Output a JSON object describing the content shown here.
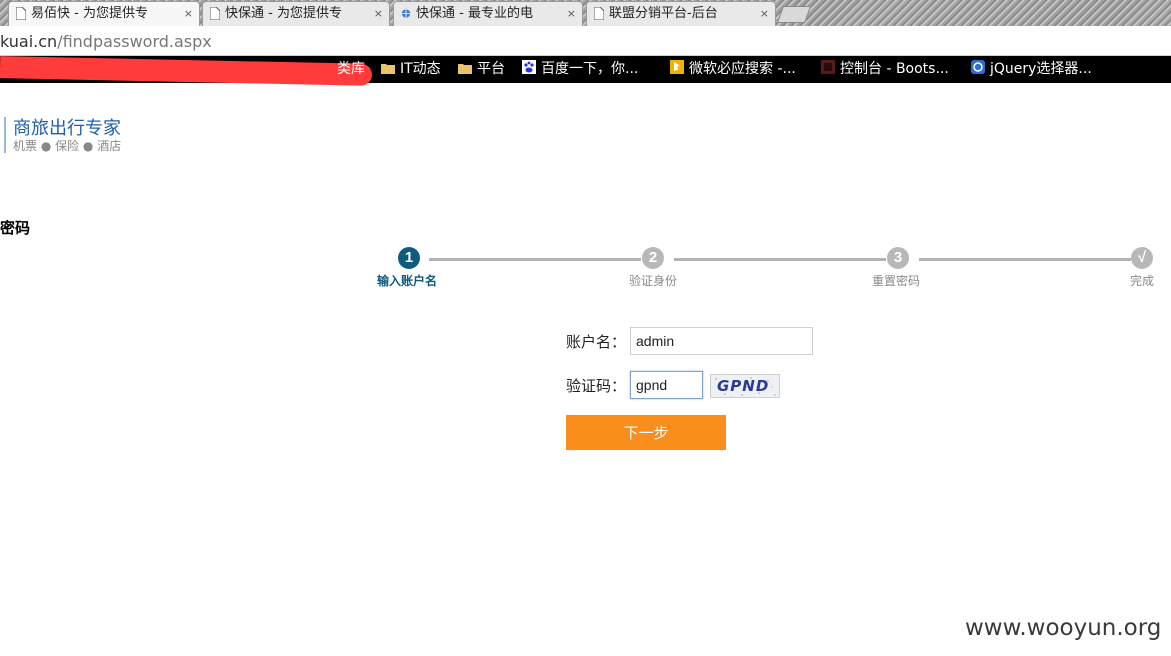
{
  "browser": {
    "tabs": [
      {
        "title": "易佰快 - 为您提供专",
        "close": "×",
        "icon": "page-icon"
      },
      {
        "title": "快保通 - 为您提供专",
        "close": "×",
        "icon": "page-icon"
      },
      {
        "title": "快保通 - 最专业的电",
        "close": "×",
        "icon": "globe-icon"
      },
      {
        "title": "联盟分销平台-后台",
        "close": "×",
        "icon": "page-icon"
      }
    ],
    "address": {
      "domain": "kuai.cn",
      "path": "/findpassword.aspx"
    },
    "bookmarks": [
      {
        "label": "类库",
        "icon": "none"
      },
      {
        "label": "IT动态",
        "icon": "folder-icon"
      },
      {
        "label": "平台",
        "icon": "folder-icon"
      },
      {
        "label": "百度一下，你...",
        "icon": "baidu-icon"
      },
      {
        "label": "微软必应搜索 -...",
        "icon": "bing-icon"
      },
      {
        "label": "控制台 - Boots...",
        "icon": "bookmark-icon"
      },
      {
        "label": "jQuery选择器...",
        "icon": "jquery-icon"
      }
    ]
  },
  "logo": {
    "title": "商旅出行专家",
    "subtitle": "机票 ● 保险 ● 酒店"
  },
  "section_heading": "密码",
  "steps": [
    {
      "number": "1",
      "label": "输入账户名",
      "active": true
    },
    {
      "number": "2",
      "label": "验证身份",
      "active": false
    },
    {
      "number": "3",
      "label": "重置密码",
      "active": false
    },
    {
      "number": "√",
      "label": "完成",
      "active": false
    }
  ],
  "form": {
    "account_label": "账户名：",
    "account_value": "admin",
    "captcha_label": "验证码：",
    "captcha_value": "gpnd",
    "captcha_image_text": "GPND",
    "next_button": "下一步"
  },
  "watermark": "www.wooyun.org",
  "colors": {
    "step_active": "#0e5b7e",
    "step_inactive": "#b8b8b8",
    "button": "#fa8e1c",
    "logo_text": "#1f5fa8"
  }
}
